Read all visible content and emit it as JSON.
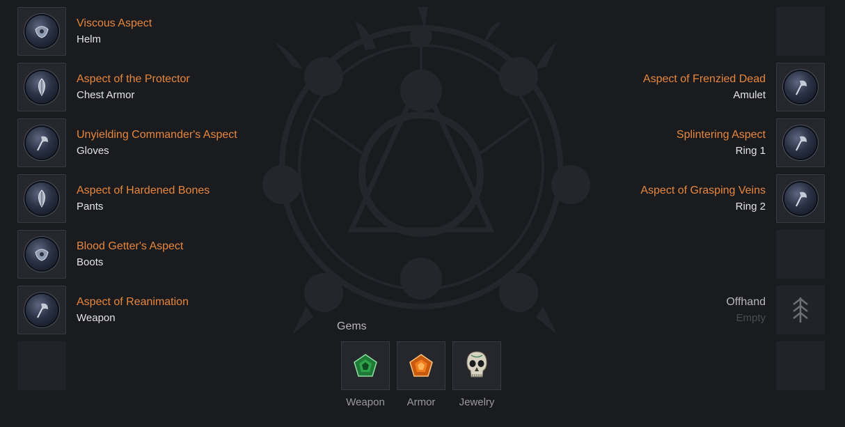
{
  "left_slots": [
    {
      "aspect": "Viscous Aspect",
      "slot": "Helm",
      "icon": "shield-orb-icon"
    },
    {
      "aspect": "Aspect of the Protector",
      "slot": "Chest Armor",
      "icon": "feather-orb-icon"
    },
    {
      "aspect": "Unyielding Commander's Aspect",
      "slot": "Gloves",
      "icon": "axe-orb-icon"
    },
    {
      "aspect": "Aspect of Hardened Bones",
      "slot": "Pants",
      "icon": "feather-orb-icon"
    },
    {
      "aspect": "Blood Getter's Aspect",
      "slot": "Boots",
      "icon": "shield-orb-icon"
    },
    {
      "aspect": "Aspect of Reanimation",
      "slot": "Weapon",
      "icon": "axe-orb-icon"
    }
  ],
  "right_slots": [
    {
      "aspect": "Aspect of Frenzied Dead",
      "slot": "Amulet",
      "icon": "axe-orb-icon"
    },
    {
      "aspect": "Splintering Aspect",
      "slot": "Ring 1",
      "icon": "axe-orb-icon"
    },
    {
      "aspect": "Aspect of Grasping Veins",
      "slot": "Ring 2",
      "icon": "axe-orb-icon"
    }
  ],
  "offhand": {
    "slot": "Offhand",
    "state": "Empty",
    "icon": "rune-tree-icon"
  },
  "gems": {
    "title": "Gems",
    "items": [
      {
        "label": "Weapon",
        "icon": "emerald-icon",
        "color": "#2fa34a"
      },
      {
        "label": "Armor",
        "icon": "topaz-icon",
        "color": "#f07a1c"
      },
      {
        "label": "Jewelry",
        "icon": "skull-icon",
        "color": "#d8d2c0"
      }
    ]
  },
  "colors": {
    "aspect": "#e8873a",
    "background": "#1a1b1f",
    "slot": "#26272c"
  }
}
